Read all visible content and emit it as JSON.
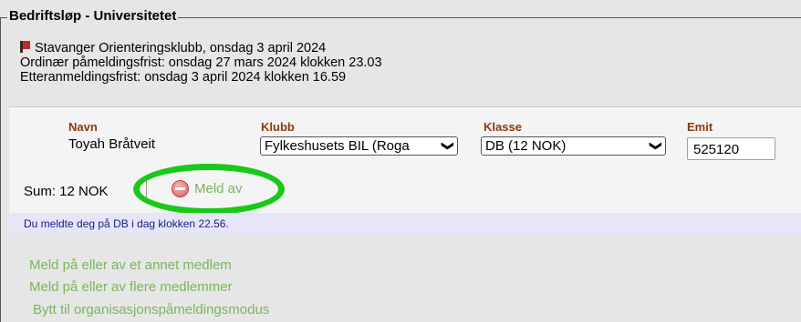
{
  "fieldset": {
    "legend": "Bedriftsløp - Universitetet"
  },
  "event": {
    "line1": "Stavanger Orienteringsklubb, onsdag 3 april 2024",
    "line2": "Ordinær påmeldingsfrist: onsdag 27 mars 2024 klokken 23.03",
    "line3": "Etteranmeldingsfrist: onsdag 3 april 2024 klokken 16.59"
  },
  "columns": {
    "name": "Navn",
    "club": "Klubb",
    "class": "Klasse",
    "emit": "Emit"
  },
  "entry": {
    "name": "Toyah Bråtveit",
    "club": "Fylkeshusets BIL (Roga",
    "class": "DB (12 NOK)",
    "emit": "525120"
  },
  "sum": "Sum: 12 NOK",
  "meld_av": "Meld av",
  "notice": "Du meldte deg på DB i dag klokken 22.56.",
  "links": {
    "other_member": "Meld på eller av et annet medlem",
    "multiple_members": "Meld på eller av flere medlemmer",
    "org_mode": "Bytt til organisasjonspåmeldingsmodus"
  },
  "colors": {
    "link": "#7ab55c",
    "highlight": "#19c919",
    "header": "#8a3a0c",
    "notice_bg": "#e6e6f8"
  }
}
